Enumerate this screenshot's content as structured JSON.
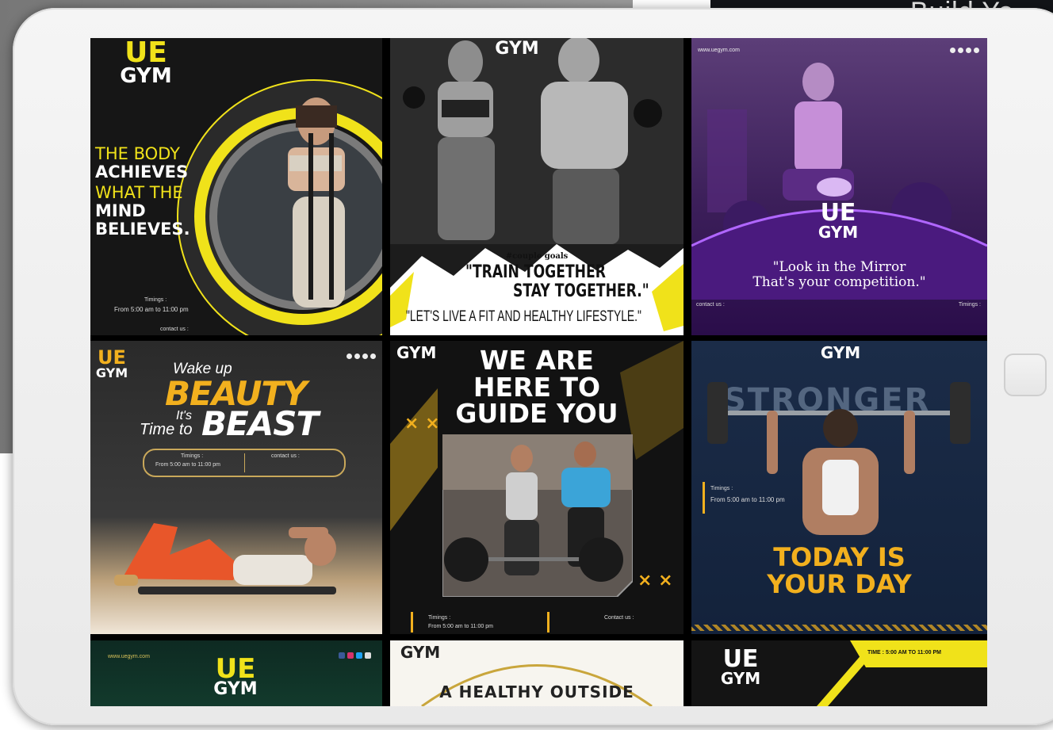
{
  "header_fragment": "Build Yo",
  "posts": {
    "p1": {
      "logo_top": "UE",
      "logo_bottom": "GYM",
      "line1": "THE BODY",
      "line2": "ACHIEVES",
      "line3": "WHAT THE",
      "line4": "MIND",
      "line5": "BELIEVES.",
      "timing_label": "Timings :",
      "timing": "From 5:00 am to 11:00 pm",
      "contact": "contact us :"
    },
    "p2": {
      "logo_bottom": "GYM",
      "hashtag": "#couple goals",
      "quote1": "\"TRAIN TOGETHER",
      "quote2": "STAY TOGETHER.\"",
      "tagline": "\"LET'S LIVE A FIT AND HEALTHY LIFESTYLE.\""
    },
    "p3": {
      "url": "www.uegym.com",
      "logo_top": "UE",
      "logo_bottom": "GYM",
      "quote1": "\"Look in the Mirror",
      "quote2": "That's your competition.\"",
      "contact_label": "contact us :",
      "timing_label": "Timings :"
    },
    "p4": {
      "logo_top": "UE",
      "logo_bottom": "GYM",
      "wake": "Wake up",
      "beauty": "BEAUTY",
      "its": "It's",
      "time_to": "Time to",
      "beast": "BEAST",
      "timing_label": "Timings :",
      "timing": "From 5:00 am to 11:00 pm",
      "contact_label": "contact us :"
    },
    "p5": {
      "logo_bottom": "GYM",
      "h1": "WE ARE",
      "h2": "HERE TO",
      "h3": "GUIDE YOU",
      "x_marks": "× ×",
      "timing_label": "Timings :",
      "timing": "From 5:00 am to 11:00 pm",
      "contact_label": "Contact us :"
    },
    "p6": {
      "logo_bottom": "GYM",
      "bg_word": "STRONGER",
      "timing_label": "Timings :",
      "timing": "From 5:00 am to 11:00 pm",
      "h1": "TODAY IS",
      "h2": "YOUR DAY"
    },
    "p7": {
      "url": "www.uegym.com",
      "logo_top": "UE",
      "logo_bottom": "GYM"
    },
    "p8": {
      "logo_bottom": "GYM",
      "headline": "A HEALTHY OUTSIDE"
    },
    "p9": {
      "logo_top": "UE",
      "logo_bottom": "GYM",
      "time": "TIME : 5:00 AM TO 11:00 PM"
    }
  },
  "colors": {
    "accent_yellow": "#f0e21a",
    "gold": "#f2b01e",
    "purple": "#6a1fb3"
  }
}
